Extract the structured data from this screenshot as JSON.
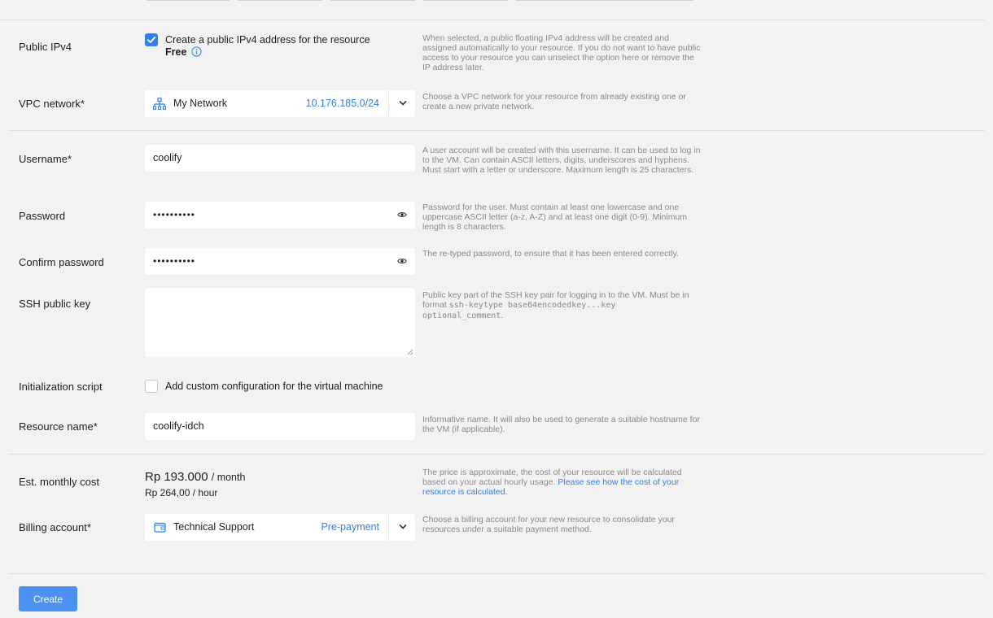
{
  "colors": {
    "accent": "#2f80ed",
    "button": "#4c90f0",
    "background": "#f2f2f2"
  },
  "ipv4": {
    "label": "Public IPv4",
    "checkbox_label": "Create a public IPv4 address for the resource",
    "free_label": "Free",
    "checked": true,
    "help": "When selected, a public floating IPv4 address will be created and assigned automatically to your resource. If you do not want to have public access to your resource you can unselect the option here or remove the IP address later."
  },
  "vpc": {
    "label": "VPC network*",
    "selected_name": "My Network",
    "selected_cidr": "10.176.185.0/24",
    "icon": "network-icon",
    "help": "Choose a VPC network for your resource from already existing one or create a new private network."
  },
  "username": {
    "label": "Username*",
    "value": "coolify",
    "help": "A user account will be created with this username. It can be used to log in to the VM. Can contain ASCII letters, digits, underscores and hyphens. Must start with a letter or underscore. Maximum length is 25 characters."
  },
  "password": {
    "label": "Password",
    "masked_value": "••••••••••",
    "help": "Password for the user. Must contain at least one lowercase and one uppercase ASCII letter (a-z, A-Z) and at least one digit (0-9). Minimum length is 8 characters."
  },
  "confirm_password": {
    "label": "Confirm password",
    "masked_value": "••••••••••",
    "help": "The re-typed password, to ensure that it has been entered correctly."
  },
  "ssh_key": {
    "label": "SSH public key",
    "value": "",
    "help_prefix": "Public key part of the SSH key pair for logging in to the VM. Must be in format ",
    "help_code": "ssh-keytype base64encodedkey...key optional_comment",
    "help_suffix": "."
  },
  "init_script": {
    "label": "Initialization script",
    "checkbox_label": "Add custom configuration for the virtual machine",
    "checked": false
  },
  "resource_name": {
    "label": "Resource name*",
    "value": "coolify-idch",
    "help": "Informative name. It will also be used to generate a suitable hostname for the VM (if applicable)."
  },
  "cost": {
    "label": "Est. monthly cost",
    "monthly_amount": "Rp 193.000",
    "monthly_unit": "/ month",
    "hourly": "Rp 264,00 / hour",
    "help_text": "The price is approximate, the cost of your resource will be calculated based on your actual hourly usage. ",
    "help_link": "Please see how the cost of your resource is calculated."
  },
  "billing": {
    "label": "Billing account*",
    "selected_name": "Technical Support",
    "selected_type": "Pre-payment",
    "icon": "wallet-icon",
    "help": "Choose a billing account for your new resource to consolidate your resources under a suitable payment method."
  },
  "actions": {
    "create_label": "Create"
  }
}
